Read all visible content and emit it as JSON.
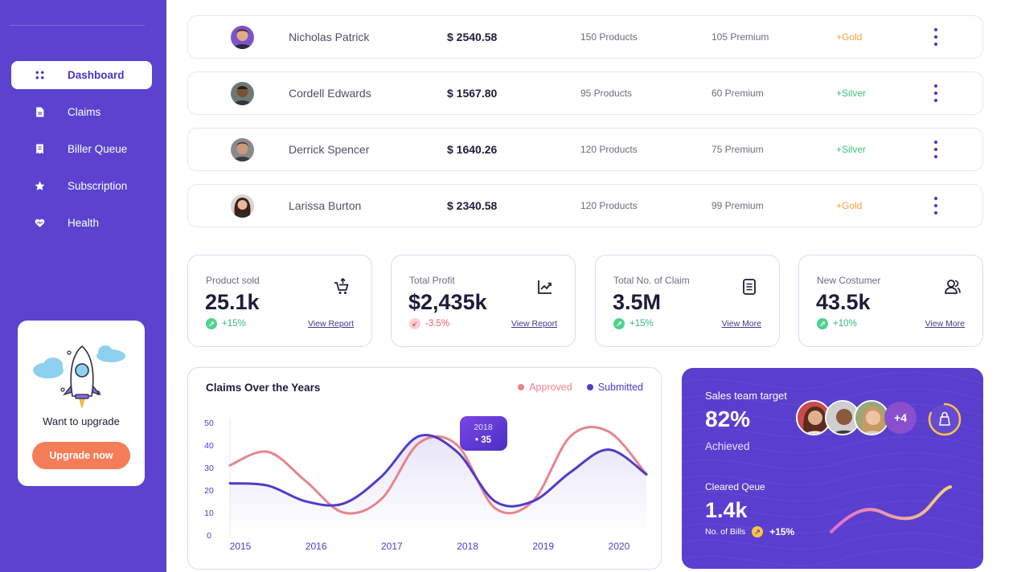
{
  "sidebar": {
    "items": [
      {
        "label": "Dashboard",
        "icon": "grid-icon",
        "active": true
      },
      {
        "label": "Claims",
        "icon": "document-icon",
        "active": false
      },
      {
        "label": "Biller Queue",
        "icon": "receipt-icon",
        "active": false
      },
      {
        "label": "Subscription",
        "icon": "star-icon",
        "active": false
      },
      {
        "label": "Health",
        "icon": "heart-icon",
        "active": false
      }
    ],
    "upgrade": {
      "text": "Want to upgrade",
      "button": "Upgrade now",
      "icon": "rocket-illustration"
    }
  },
  "customers": [
    {
      "name": "Nicholas Patrick",
      "amount": "$ 2540.58",
      "products": "150 Products",
      "premium": "105 Premium",
      "tier": "+Gold"
    },
    {
      "name": "Cordell Edwards",
      "amount": "$ 1567.80",
      "products": "95 Products",
      "premium": "60 Premium",
      "tier": "+Silver"
    },
    {
      "name": "Derrick Spencer",
      "amount": "$ 1640.26",
      "products": "120 Products",
      "premium": "75 Premium",
      "tier": "+Silver"
    },
    {
      "name": "Larissa Burton",
      "amount": "$ 2340.58",
      "products": "120 Products",
      "premium": "99 Premium",
      "tier": "+Gold"
    }
  ],
  "stats": [
    {
      "title": "Product sold",
      "value": "25.1k",
      "change": "+15%",
      "direction": "up",
      "link": "View Report",
      "icon": "cart-icon"
    },
    {
      "title": "Total Profit",
      "value": "$2,435k",
      "change": "-3.5%",
      "direction": "down",
      "link": "View Report",
      "icon": "trend-chart-icon"
    },
    {
      "title": "Total No. of Claim",
      "value": "3.5M",
      "change": "+15%",
      "direction": "up",
      "link": "View More",
      "icon": "document-icon"
    },
    {
      "title": "New Costumer",
      "value": "43.5k",
      "change": "+10%",
      "direction": "up",
      "link": "View More",
      "icon": "users-icon"
    }
  ],
  "claims_chart": {
    "title": "Claims Over the Years",
    "tooltip": {
      "year": "2018",
      "value": "• 35"
    }
  },
  "chart_data": {
    "type": "line",
    "title": "Claims Over the Years",
    "x": [
      2015,
      2015.5,
      2016,
      2016.5,
      2017,
      2017.5,
      2018,
      2018.5,
      2019,
      2019.5,
      2020,
      2020.5
    ],
    "xticks": [
      "2015",
      "2016",
      "2017",
      "2018",
      "2019",
      "2020"
    ],
    "yticks": [
      "0",
      "10",
      "20",
      "30",
      "40",
      "50"
    ],
    "ylim": [
      0,
      50
    ],
    "series": [
      {
        "name": "Approved",
        "color": "#e8848d",
        "values": [
          31,
          37,
          24,
          10,
          16,
          41,
          40,
          12,
          15,
          44,
          46,
          27
        ]
      },
      {
        "name": "Submitted",
        "color": "#4f3cc9",
        "values": [
          23,
          22,
          15,
          14,
          26,
          44,
          37,
          15,
          15,
          28,
          38,
          27
        ]
      }
    ],
    "legend": "top-right",
    "grid": false
  },
  "target": {
    "title": "Sales team target",
    "percent": "82%",
    "achieved": "Achieved",
    "extra_members": "+4",
    "queue_title": "Cleared Qeue",
    "queue_value": "1.4k",
    "bills_label": "No. of Bills",
    "bills_change": "+15%",
    "progress": 0.82
  }
}
